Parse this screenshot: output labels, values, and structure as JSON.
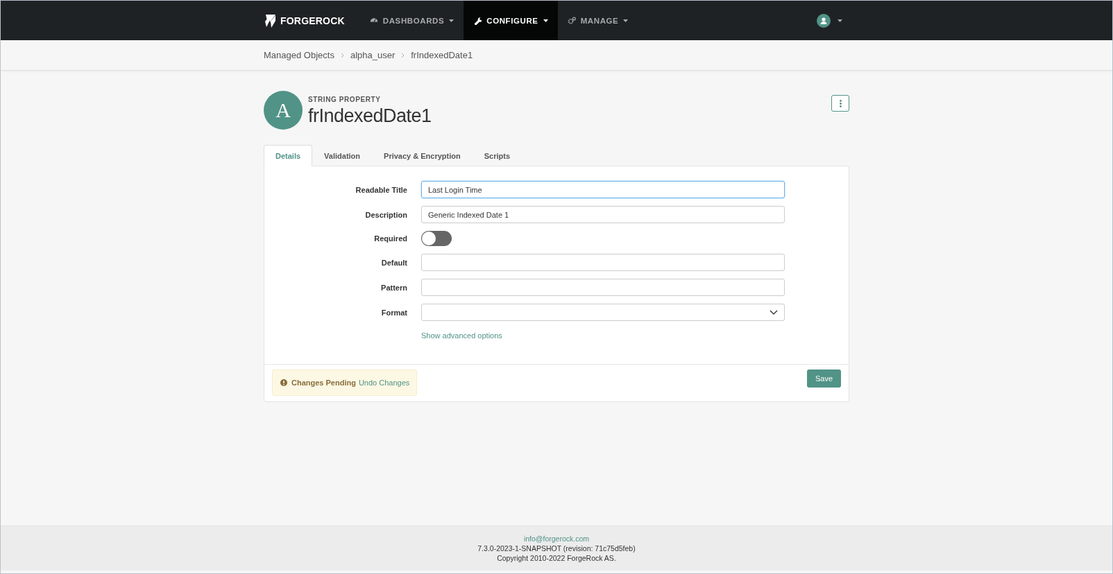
{
  "navbar": {
    "brand": "FORGEROCK",
    "menus": [
      {
        "label": "DASHBOARDS",
        "selected": false
      },
      {
        "label": "CONFIGURE",
        "selected": true
      },
      {
        "label": "MANAGE",
        "selected": false
      }
    ]
  },
  "breadcrumbs": [
    "Managed Objects",
    "alpha_user",
    "frIndexedDate1"
  ],
  "header": {
    "avatar_letter": "A",
    "subtitle": "STRING PROPERTY",
    "title": "frIndexedDate1"
  },
  "tabs": [
    {
      "label": "Details",
      "selected": true
    },
    {
      "label": "Validation",
      "selected": false
    },
    {
      "label": "Privacy & Encryption",
      "selected": false
    },
    {
      "label": "Scripts",
      "selected": false
    }
  ],
  "form": {
    "fields": [
      {
        "kind": "text",
        "label": "Readable Title",
        "value": "Last Login Time",
        "focused": true
      },
      {
        "kind": "text",
        "label": "Description",
        "value": "Generic Indexed Date 1",
        "focused": false
      },
      {
        "kind": "toggle",
        "label": "Required",
        "on": false
      },
      {
        "kind": "text",
        "label": "Default",
        "focused": false
      },
      {
        "kind": "text",
        "label": "Pattern",
        "focused": false
      },
      {
        "kind": "select",
        "label": "Format"
      }
    ],
    "advanced_link": "Show advanced options"
  },
  "alert": {
    "title": "Changes Pending",
    "link": "Undo Changes"
  },
  "save_button": "Save",
  "footer": {
    "email": "info@forgerock.com",
    "version": "7.3.0-2023-1-SNAPSHOT (revision: 71c75d5feb)",
    "copyright": "Copyright 2010-2022 ForgeRock AS."
  }
}
